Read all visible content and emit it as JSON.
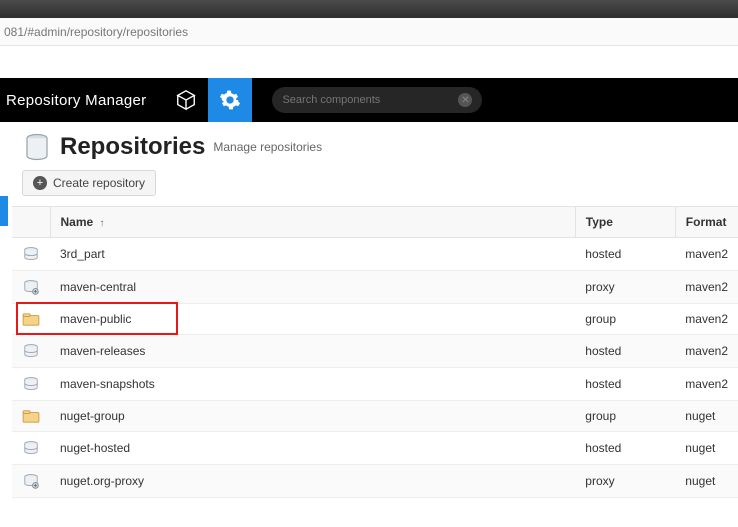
{
  "browser": {
    "url_fragment": "081/#admin/repository/repositories"
  },
  "header": {
    "brand": "Repository Manager",
    "search_placeholder": "Search components"
  },
  "page": {
    "title": "Repositories",
    "subtitle": "Manage repositories",
    "create_label": "Create repository"
  },
  "table": {
    "columns": {
      "name": "Name",
      "type": "Type",
      "format": "Format"
    },
    "rows": [
      {
        "name": "3rd_part",
        "type": "hosted",
        "format": "maven2",
        "icon": "hosted"
      },
      {
        "name": "maven-central",
        "type": "proxy",
        "format": "maven2",
        "icon": "proxy"
      },
      {
        "name": "maven-public",
        "type": "group",
        "format": "maven2",
        "icon": "group"
      },
      {
        "name": "maven-releases",
        "type": "hosted",
        "format": "maven2",
        "icon": "hosted"
      },
      {
        "name": "maven-snapshots",
        "type": "hosted",
        "format": "maven2",
        "icon": "hosted"
      },
      {
        "name": "nuget-group",
        "type": "group",
        "format": "nuget",
        "icon": "group"
      },
      {
        "name": "nuget-hosted",
        "type": "hosted",
        "format": "nuget",
        "icon": "hosted"
      },
      {
        "name": "nuget.org-proxy",
        "type": "proxy",
        "format": "nuget",
        "icon": "proxy"
      }
    ]
  },
  "highlight_row_index": 2
}
